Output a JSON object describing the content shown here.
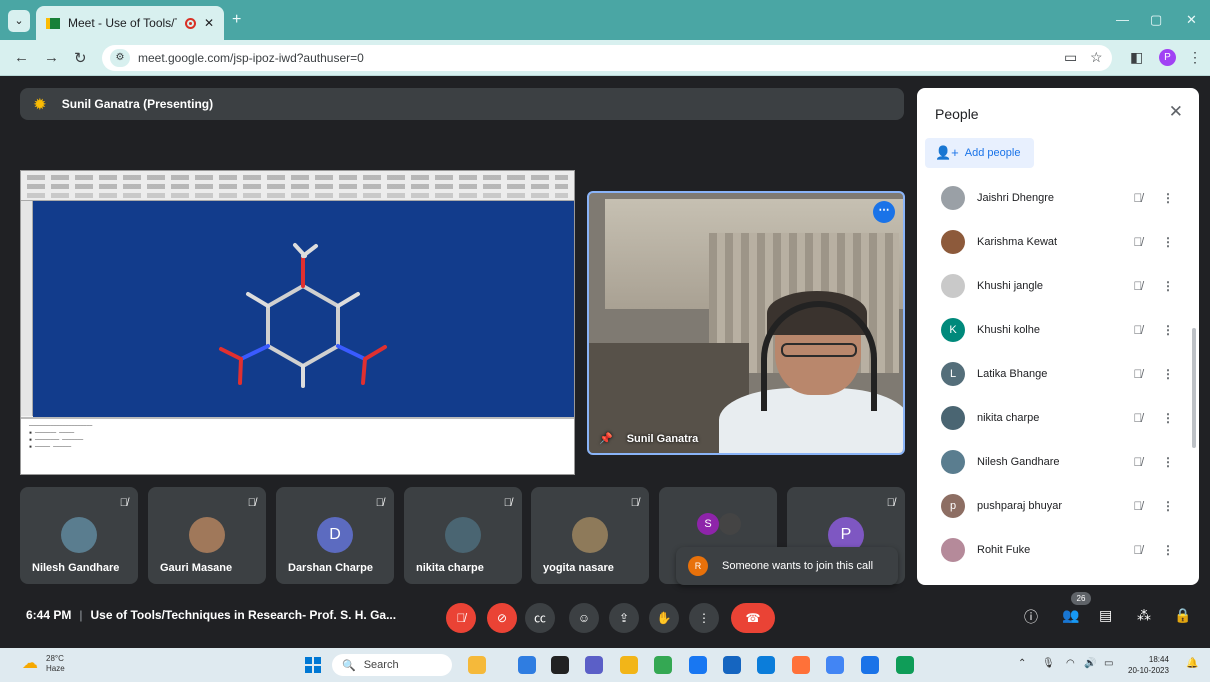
{
  "browser": {
    "tab_title": "Meet - Use of Tools/Techni",
    "url": "meet.google.com/jsp-ipoz-iwd?authuser=0",
    "profile_initial": "P"
  },
  "meet": {
    "presenter_label": "Sunil Ganatra (Presenting)",
    "speaker_name": "Sunil Ganatra",
    "tiles": [
      {
        "name": "Nilesh Gandhare",
        "initial": "",
        "color": "#5a7d8f"
      },
      {
        "name": "Gauri Masane",
        "initial": "",
        "color": "#a0785a"
      },
      {
        "name": "Darshan Charpe",
        "initial": "D",
        "color": "#5c6bc0"
      },
      {
        "name": "nikita charpe",
        "initial": "",
        "color": "#4a6572"
      },
      {
        "name": "yogita nasare",
        "initial": "",
        "color": "#8e7a5a"
      },
      {
        "name": "",
        "initial": "S",
        "color": "#8e24aa"
      },
      {
        "name": "",
        "initial": "P",
        "color": "#7e57c2"
      }
    ],
    "join_toast": {
      "avatar": "R",
      "text": "Someone wants to join this call"
    },
    "meeting_time": "6:44 PM",
    "meeting_title": "Use of Tools/Techniques in Research- Prof. S. H. Ga...",
    "participant_count": "26"
  },
  "people_panel": {
    "title": "People",
    "add_label": "Add people",
    "participants": [
      {
        "name": "Jaishri Dhengre",
        "initial": "",
        "color": "#9aa0a6"
      },
      {
        "name": "Karishma Kewat",
        "initial": "",
        "color": "#8d5a3b"
      },
      {
        "name": "Khushi jangle",
        "initial": "",
        "color": "#c9c9c9"
      },
      {
        "name": "Khushi kolhe",
        "initial": "K",
        "color": "#00897b"
      },
      {
        "name": "Latika Bhange",
        "initial": "L",
        "color": "#546e7a"
      },
      {
        "name": "nikita charpe",
        "initial": "",
        "color": "#4a6572"
      },
      {
        "name": "Nilesh Gandhare",
        "initial": "",
        "color": "#5a7d8f"
      },
      {
        "name": "pushparaj bhuyar",
        "initial": "p",
        "color": "#8d6e63"
      },
      {
        "name": "Rohit Fuke",
        "initial": "",
        "color": "#b58a9a"
      }
    ]
  },
  "taskbar": {
    "temperature": "28°C",
    "weather": "Haze",
    "search_placeholder": "Search",
    "time": "18:44",
    "date": "20-10-2023"
  }
}
